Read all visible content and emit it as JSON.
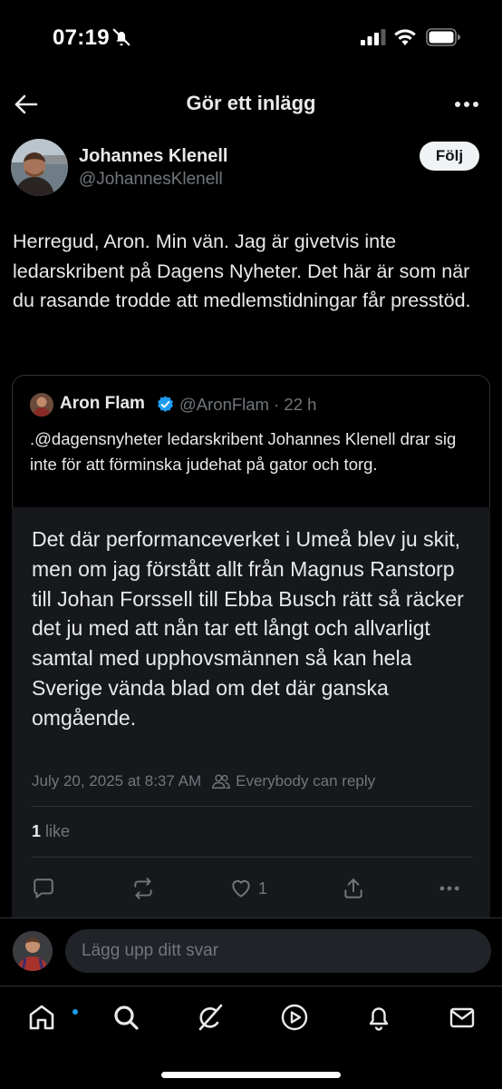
{
  "status_bar": {
    "time": "07:19",
    "icons": [
      "bell-off-icon",
      "signal-icon",
      "wifi-icon",
      "battery-icon"
    ]
  },
  "nav": {
    "title": "Gör ett inlägg",
    "back_icon": "arrow-left-icon",
    "more_icon": "more-horizontal-icon"
  },
  "post": {
    "author_name": "Johannes Klenell",
    "author_handle": "@JohannesKlenell",
    "follow_label": "Följ",
    "text": "Herregud, Aron. Min vän. Jag är givetvis inte ledarskribent på Dagens Nyheter. Det här är som när du rasande trodde att medlemstidningar får presstöd."
  },
  "quote": {
    "author_name": "Aron Flam",
    "handle_time": "@AronFlam · 22 h",
    "text": ".@dagensnyheter ledarskribent Johannes Klenell drar sig inte för att förminska judehat på gator och torg."
  },
  "embedded": {
    "text": "Det där performanceverket i Umeå blev ju skit, men om jag förstått allt från Magnus Ranstorp till Johan Forssell till Ebba Busch rätt så räcker det ju med att nån tar ett långt och allvarligt samtal med upphovsmännen så kan hela Sverige vända blad om det där ganska omgående.",
    "timestamp": "July 20, 2025 at 8:37 AM",
    "reply_setting": "Everybody can reply",
    "likes_count": "1",
    "likes_label": " like",
    "actions": {
      "reply_icon": "comment-icon",
      "repost_icon": "repost-icon",
      "like_icon": "heart-icon",
      "like_count": "1",
      "share_icon": "share-icon",
      "more_icon": "more-horizontal-icon"
    }
  },
  "reply": {
    "placeholder": "Lägg upp ditt svar"
  },
  "tabs": [
    {
      "name": "home",
      "icon": "home-icon",
      "active": true,
      "notification_dot": true
    },
    {
      "name": "search",
      "icon": "search-icon"
    },
    {
      "name": "grok",
      "icon": "grok-icon"
    },
    {
      "name": "video",
      "icon": "play-icon"
    },
    {
      "name": "notifications",
      "icon": "bell-icon"
    },
    {
      "name": "messages",
      "icon": "mail-icon"
    }
  ],
  "colors": {
    "background": "#000000",
    "text_primary": "#e7e9ea",
    "text_secondary": "#71767b",
    "accent": "#1d9bf0",
    "card_panel": "#16181c",
    "border": "#2f3336"
  }
}
